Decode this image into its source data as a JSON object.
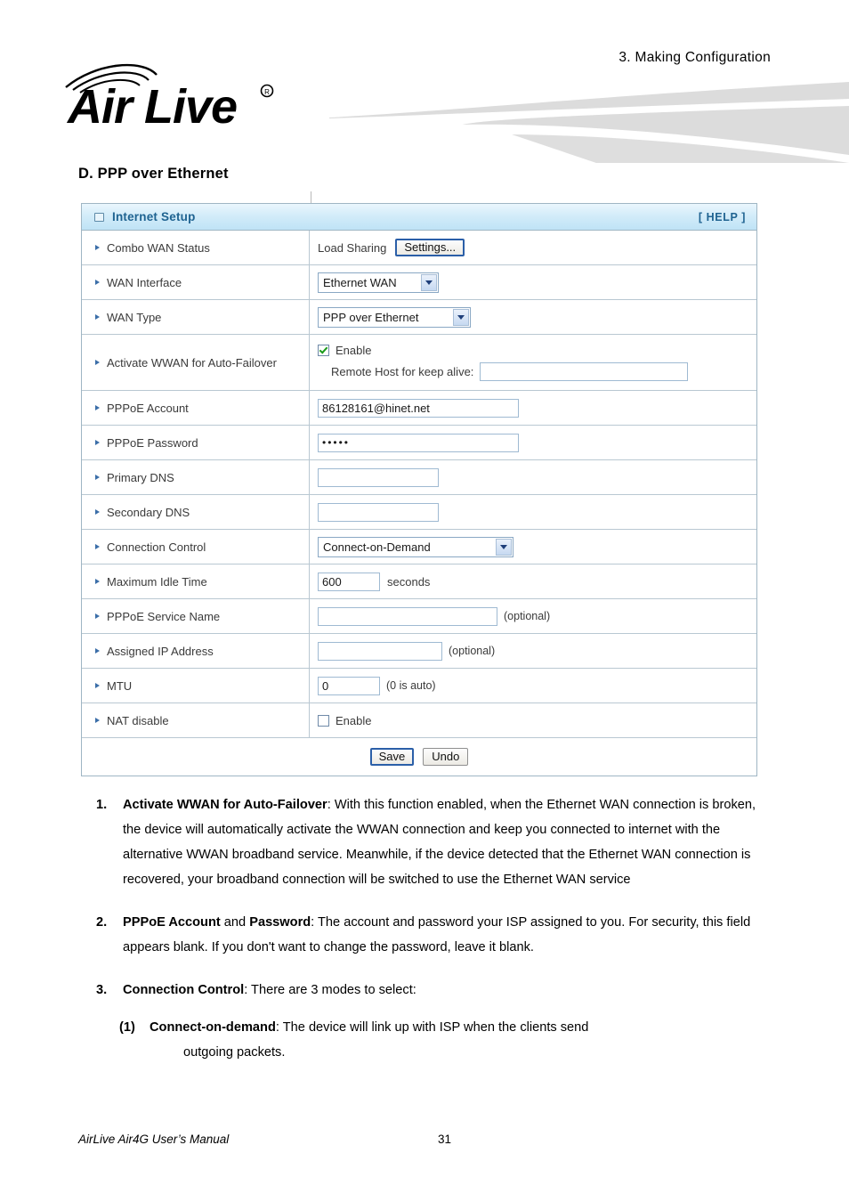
{
  "header": {
    "chapter": "3.  Making  Configuration",
    "logo_text": "Air Live",
    "logo_mark": "wifi-arcs"
  },
  "section": {
    "title": "D. PPP over Ethernet"
  },
  "panel": {
    "title": "Internet Setup",
    "help_label": "[ HELP ]",
    "collapse_icon": "collapse-box-icon",
    "rows": [
      {
        "label": "Combo WAN Status",
        "mode_text": "Load Sharing",
        "button_label": "Settings..."
      },
      {
        "label": "WAN Interface",
        "select_value": "Ethernet WAN"
      },
      {
        "label": "WAN Type",
        "select_value": "PPP over Ethernet"
      },
      {
        "label": "Activate WWAN for Auto-Failover",
        "checkbox_label": "Enable",
        "checkbox_checked": true,
        "keepalive_label": "Remote Host for keep alive:",
        "keepalive_value": ""
      },
      {
        "label": "PPPoE Account",
        "value": "86128161@hinet.net"
      },
      {
        "label": "PPPoE Password",
        "value": "•••••"
      },
      {
        "label": "Primary DNS",
        "value": ""
      },
      {
        "label": "Secondary DNS",
        "value": ""
      },
      {
        "label": "Connection Control",
        "select_value": "Connect-on-Demand"
      },
      {
        "label": "Maximum Idle Time",
        "value": "600",
        "unit": "seconds"
      },
      {
        "label": "PPPoE Service Name",
        "value": "",
        "hint": "(optional)"
      },
      {
        "label": "Assigned IP Address",
        "value": "",
        "hint": "(optional)"
      },
      {
        "label": "MTU",
        "value": "0",
        "hint": "(0 is auto)"
      },
      {
        "label": "NAT disable",
        "checkbox_label": "Enable",
        "checkbox_checked": false
      }
    ],
    "save_label": "Save",
    "undo_label": "Undo"
  },
  "notes": [
    {
      "num": "1.",
      "bold": "Activate WWAN for Auto-Failover",
      "rest": ": With this function enabled, when the Ethernet WAN connection is broken, the device will automatically activate the WWAN connection and keep you connected to internet with the alternative WWAN broadband service. Meanwhile, if the device detected that the Ethernet WAN connection is recovered, your broadband connection will be switched to use the Ethernet WAN service"
    },
    {
      "num": "2.",
      "bold": "PPPoE Account",
      "mid": " and ",
      "bold2": "Password",
      "rest": ": The account and password your ISP assigned to you. For security, this field appears blank. If you don't want to change the password, leave it blank."
    },
    {
      "num": "3.",
      "bold": "Connection Control",
      "rest": ": There are 3 modes to select:"
    }
  ],
  "subnote": {
    "num": "(1)",
    "bold": "Connect-on-demand",
    "rest": ": The device will link up with ISP when the clients send",
    "cont": "outgoing packets."
  },
  "footer": {
    "manual": "AirLive Air4G User’s Manual",
    "page": "31"
  },
  "colors": {
    "panel_header_blue": "#1f6391",
    "bullet_blue": "#3b6ea8",
    "check_green": "#1a9b1a",
    "focus_blue": "#2b5fa8",
    "swoosh_gray": "#dcdcdc"
  }
}
